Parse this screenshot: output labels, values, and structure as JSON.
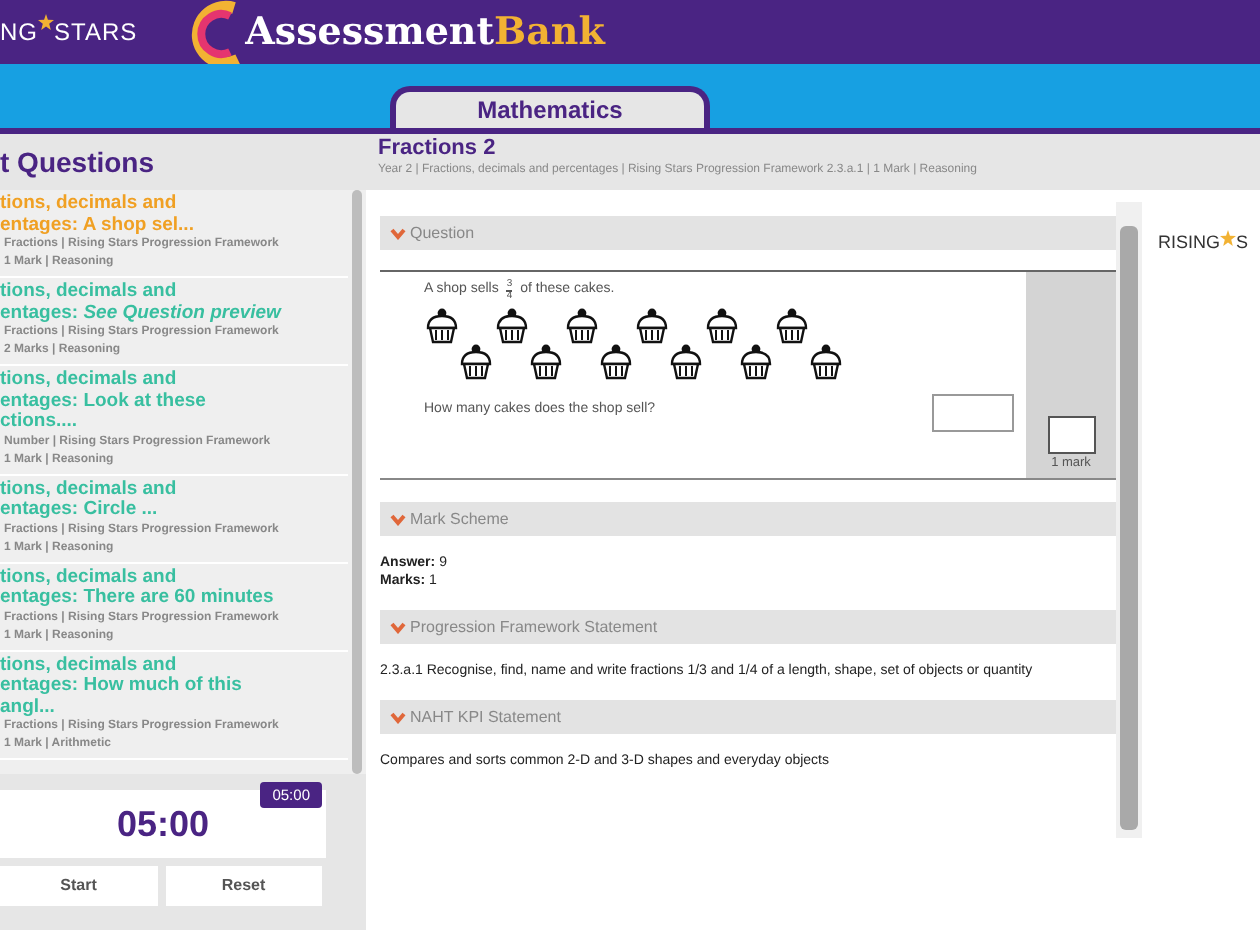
{
  "header": {
    "logo_text": "NG",
    "logo_text_2": "STARS",
    "brand": "Assessment",
    "brand_2": "Bank"
  },
  "subject_tabs": [
    {
      "label": "Mathematics",
      "selected": true
    }
  ],
  "sidebar": {
    "title": "t Questions",
    "items": [
      {
        "title_lines": [
          "tions, decimals and",
          "entages: A shop sel..."
        ],
        "meta_lines": [
          "Fractions | Rising Stars Progression Framework",
          "1 Mark | Reasoning"
        ],
        "selected": true
      },
      {
        "title_lines": [
          "tions, decimals and",
          "entages: *See Question preview*"
        ],
        "meta_lines": [
          "Fractions | Rising Stars Progression Framework",
          "2 Marks | Reasoning"
        ],
        "selected": false
      },
      {
        "title_lines": [
          "tions, decimals and",
          "entages: Look at these",
          "ctions...."
        ],
        "meta_lines": [
          "Number | Rising Stars Progression Framework",
          "1 Mark | Reasoning"
        ],
        "selected": false
      },
      {
        "title_lines": [
          "tions, decimals and",
          "entages: Circle ..."
        ],
        "meta_lines": [
          "Fractions | Rising Stars Progression Framework",
          "1 Mark | Reasoning"
        ],
        "selected": false
      },
      {
        "title_lines": [
          "tions, decimals and",
          "entages: There are 60 minutes"
        ],
        "meta_lines": [
          "Fractions | Rising Stars Progression Framework",
          "1 Mark | Reasoning"
        ],
        "selected": false
      },
      {
        "title_lines": [
          "tions, decimals and",
          "entages: How much of this",
          "angl..."
        ],
        "meta_lines": [
          "Fractions | Rising Stars Progression Framework",
          "1 Mark | Arithmetic"
        ],
        "selected": false
      }
    ]
  },
  "timer": {
    "display": "05:00",
    "badge": "05:00",
    "buttons": [
      "Start",
      "Reset"
    ]
  },
  "question": {
    "title": "Fractions 2",
    "meta": "Year 2 | Fractions, decimals and percentages | Rising Stars Progression Framework 2.3.a.1 | 1 Mark | Reasoning",
    "sections": [
      {
        "kind": "question",
        "heading": "Question",
        "expanded": true,
        "prompt_before": "A shop sells",
        "numerator": "3",
        "denominator": "4",
        "prompt_after": "of these cakes.",
        "question": "How many cakes does the shop sell?",
        "mark_label": "1 mark"
      },
      {
        "kind": "lines",
        "heading": "Mark Scheme",
        "expanded": true,
        "lines": [
          "**Answer:** 9",
          "**Marks:** 1"
        ]
      },
      {
        "kind": "text",
        "heading": "Progression Framework Statement",
        "expanded": true,
        "text": "2.3.a.1 Recognise, find, name and write fractions 1/3 and 1/4 of a length, shape, set of objects or quantity"
      },
      {
        "kind": "text",
        "heading": "NAHT KPI Statement",
        "expanded": true,
        "text": "Compares and sorts common 2-D and 3-D shapes and everyday objects"
      }
    ]
  },
  "side_logo": {
    "text": "RISING",
    "text_2": "S"
  }
}
